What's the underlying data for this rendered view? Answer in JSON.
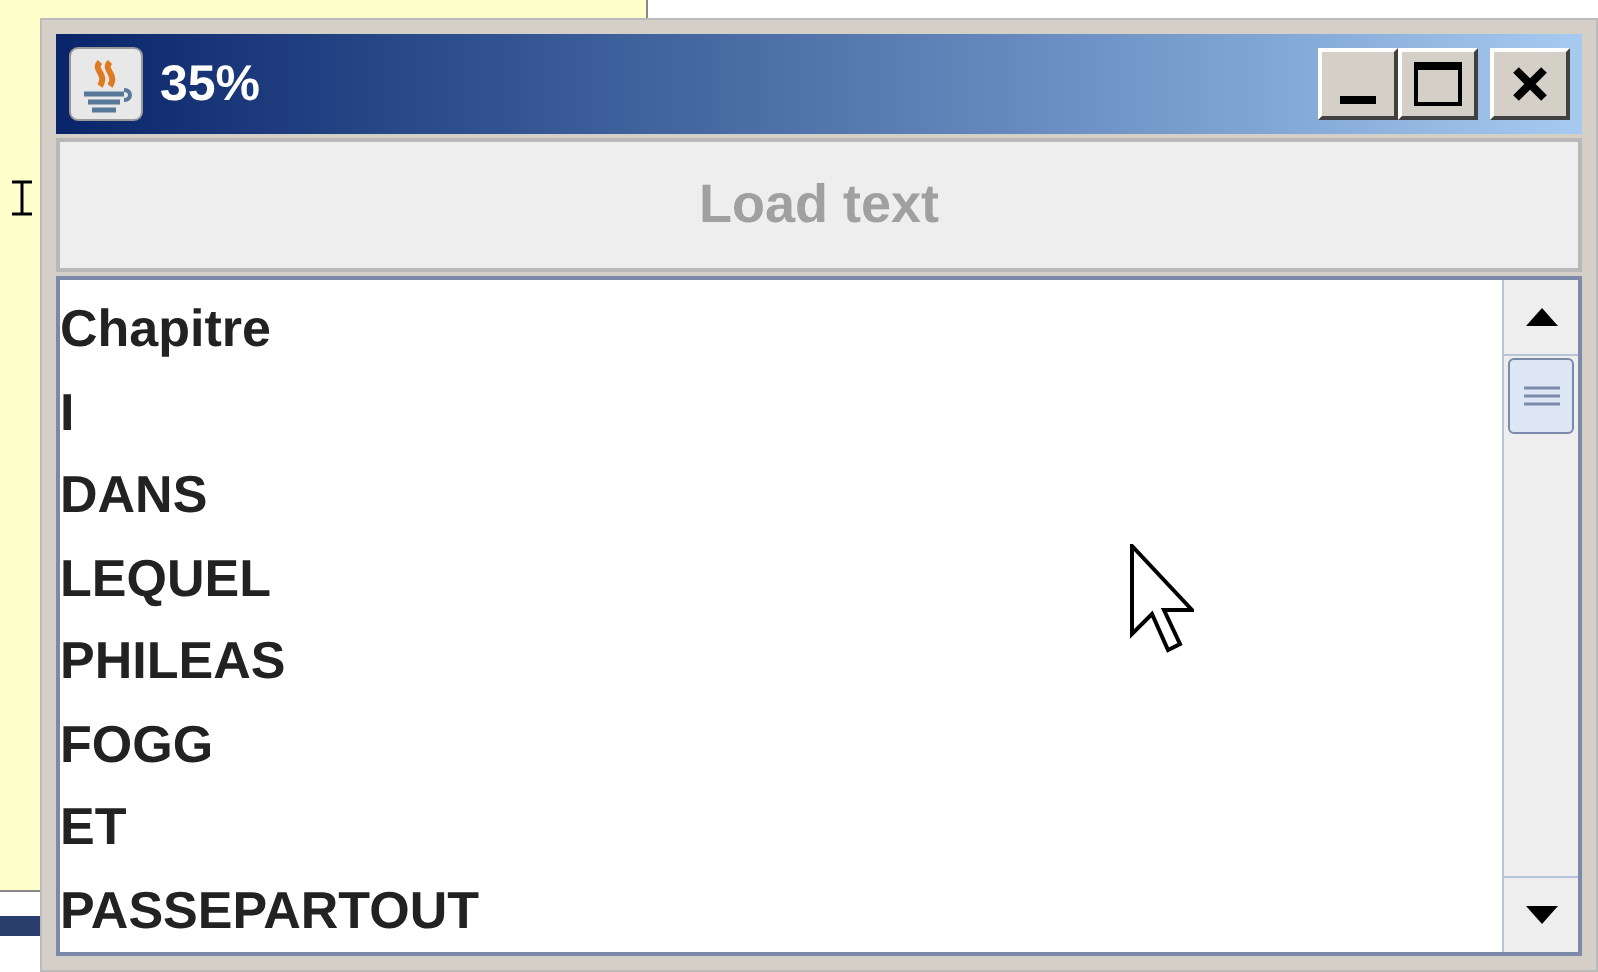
{
  "window": {
    "title": "35%"
  },
  "load_button": {
    "label": "Load text",
    "disabled": true
  },
  "list": {
    "items": [
      "Chapitre",
      "I",
      "DANS",
      "LEQUEL",
      "PHILEAS",
      "FOGG",
      "ET",
      "PASSEPARTOUT"
    ]
  }
}
